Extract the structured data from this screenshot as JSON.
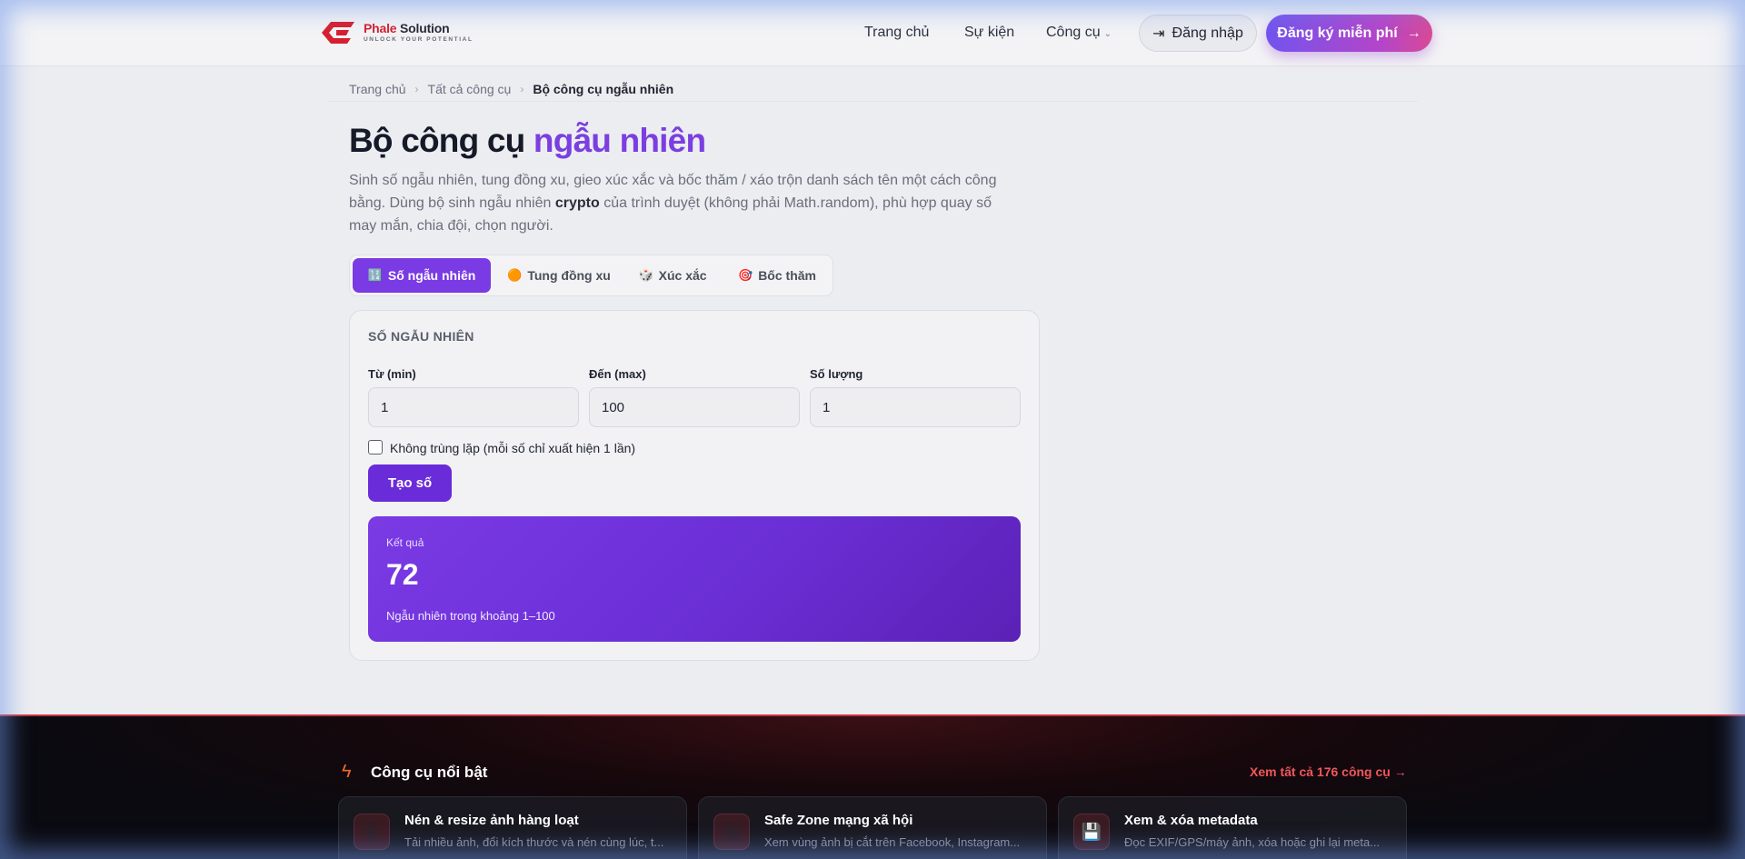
{
  "header": {
    "brand_red": "Phale",
    "brand_rest": " Solution",
    "tagline": "UNLOCK YOUR POTENTIAL",
    "nav": [
      "Trang chủ",
      "Sự kiện",
      "Công cụ"
    ],
    "login": "Đăng nhập",
    "signup": "Đăng ký miễn phí"
  },
  "breadcrumb": [
    "Trang chủ",
    "Tất cả công cụ",
    "Bộ công cụ ngẫu nhiên"
  ],
  "title": {
    "main": "Bộ công cụ ",
    "accent": "ngẫu nhiên"
  },
  "description": {
    "part1": "Sinh số ngẫu nhiên, tung đồng xu, gieo xúc xắc và bốc thăm / xáo trộn danh sách tên một cách công bằng. Dùng bộ sinh ngẫu nhiên ",
    "bold": "crypto",
    "part2": " của trình duyệt (không phải Math.random), phù hợp quay số may mắn, chia đội, chọn người."
  },
  "tabs": [
    {
      "icon": "🔢",
      "label": "Số ngẫu nhiên"
    },
    {
      "icon": "🟠",
      "label": "Tung đồng xu"
    },
    {
      "icon": "🎲",
      "label": "Xúc xắc"
    },
    {
      "icon": "🎯",
      "label": "Bốc thăm"
    }
  ],
  "card": {
    "title": "SỐ NGẪU NHIÊN",
    "fields": [
      {
        "label": "Từ (min)",
        "value": "1"
      },
      {
        "label": "Đến (max)",
        "value": "100"
      },
      {
        "label": "Số lượng",
        "value": "1"
      }
    ],
    "checkbox_label": "Không trùng lặp (mỗi số chỉ xuất hiện 1 lần)",
    "button": "Tạo số",
    "result_label": "Kết quả",
    "result_value": "72",
    "result_note": "Ngẫu nhiên trong khoảng 1–100"
  },
  "featured": {
    "title": "Công cụ nổi bật",
    "link": "Xem tất cả 176 công cụ →",
    "tools": [
      {
        "icon": "🗜",
        "name": "Nén & resize ảnh hàng loạt",
        "desc": "Tải nhiều ảnh, đổi kích thước và nén cùng lúc, t..."
      },
      {
        "icon": "🖼",
        "name": "Safe Zone mạng xã hội",
        "desc": "Xem vùng ảnh bị cắt trên Facebook, Instagram..."
      },
      {
        "icon": "💾",
        "name": "Xem & xóa metadata",
        "desc": "Đọc EXIF/GPS/máy ảnh, xóa hoặc ghi lại meta..."
      }
    ]
  },
  "colors": {
    "accent": "#7a3ae4",
    "brand_red": "#d6202f",
    "dark_bg": "#0a0a10"
  }
}
